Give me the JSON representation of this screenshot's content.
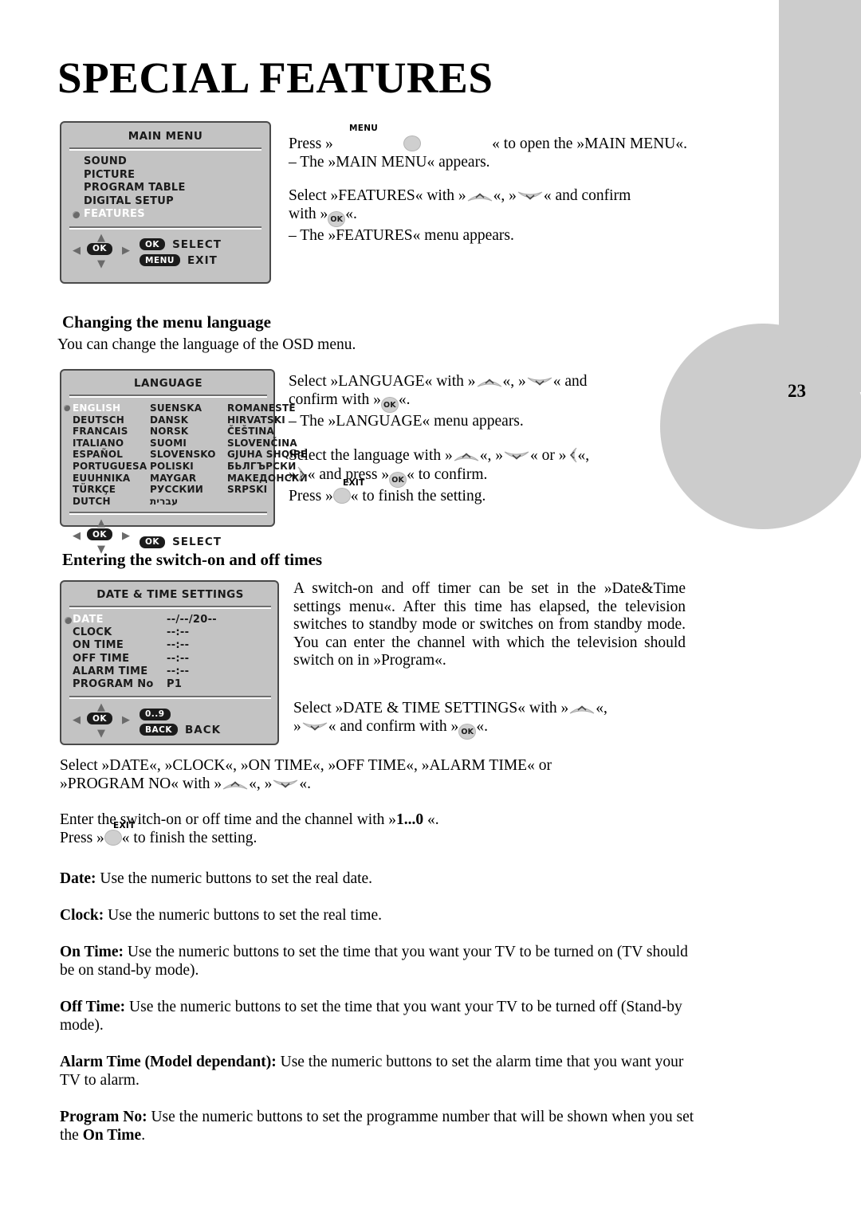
{
  "page": {
    "title": "SPECIAL FEATURES",
    "number": "23"
  },
  "main_menu_osd": {
    "title": "MAIN MENU",
    "items": [
      "SOUND",
      "PICTURE",
      "PROGRAM TABLE",
      "DIGITAL SETUP",
      "FEATURES"
    ],
    "selected": "FEATURES",
    "nav": {
      "ok_key": "OK",
      "ok_action": "SELECT",
      "menu_key": "MENU",
      "menu_action": "EXIT"
    }
  },
  "intro": {
    "line1_a": "Press »",
    "line1_b": "« to open the »MAIN MENU«.",
    "menu_key_label": "MENU",
    "line2": "– The »MAIN MENU« appears.",
    "line3_a": "Select »FEATURES« with »",
    "line3_b": "«, »",
    "line3_c": "« and confirm",
    "line4_a": "with »",
    "line4_b": "«.",
    "ok_key_label": "OK",
    "line5": "– The »FEATURES« menu appears."
  },
  "language_section": {
    "heading": "Changing the menu language",
    "intro": "You can change the language of the OSD menu.",
    "osd": {
      "title": "LANGUAGE",
      "columns": [
        [
          "ENGLISH",
          "DEUTSCH",
          "FRANCAIS",
          "ITALIANO",
          "ESPAÑOL",
          "PORTUGUESA",
          "EUUHNIKA",
          "TÜRKÇE",
          "DUTCH"
        ],
        [
          "SUENSKA",
          "DANSK",
          "NORSK",
          "SUOMI",
          "SLOVENSKO",
          "POLISKI",
          "MAYGAR",
          "РУССКИИ",
          "עברית"
        ],
        [
          "ROMANESTE",
          "HIRVATSKI",
          "ČEŠTINA",
          "SLOVENČINA",
          "GJUHA SHQIPE",
          "БЬЛГЪРСКИ",
          "МАКЕДОНСКИ",
          "SRPSKI",
          ""
        ]
      ],
      "selected": "ENGLISH",
      "nav": {
        "ok_key": "OK",
        "ok_action": "SELECT"
      }
    },
    "text": {
      "p1_a": "Select  »LANGUAGE«  with  »",
      "p1_b": "«, »",
      "p1_c": "« and",
      "p2_a": " confirm   with »",
      "p2_b": "«.",
      "p3": "– The »LANGUAGE« menu appears.",
      "p4_a": "Select  the  language  with  »",
      "p4_b": "«, »",
      "p4_c": "« or »",
      "p4_d": "«,",
      "p5_a": "»",
      "p5_b": "« and  press  »",
      "p5_c": "«  to  confirm.",
      "p6_a": "Press »",
      "p6_b": "« to finish the setting.",
      "exit_key_label": "EXIT",
      "ok_key_label": "OK"
    }
  },
  "timer_section": {
    "heading": "Entering the switch-on and off times",
    "osd": {
      "title": "DATE & TIME SETTINGS",
      "rows": [
        {
          "key": "DATE",
          "value": "--/--/20--"
        },
        {
          "key": "CLOCK",
          "value": "--:--"
        },
        {
          "key": "ON TIME",
          "value": "--:--"
        },
        {
          "key": "OFF TIME",
          "value": "--:--"
        },
        {
          "key": "ALARM TIME",
          "value": "--:--"
        },
        {
          "key": "PROGRAM No",
          "value": "P1"
        }
      ],
      "selected": "DATE",
      "nav": {
        "ok_key": "OK",
        "numeric_key": "0..9",
        "back_key": "BACK",
        "back_action": "BACK"
      }
    },
    "paragraph": "A switch-on and off timer can be set in the »Date&Time settings menu«. After this time has elapsed, the television switches to standby mode or switches on from standby mode. You can enter the channel  with  which the television should switch on in »Program«.",
    "select_line_a": "Select »DATE & TIME SETTINGS« with »",
    "select_line_b": "«,",
    "select_line_c": "»",
    "select_line_d": "« and confirm with »",
    "select_line_e": "«.",
    "ok_key_label": "OK",
    "select_items_a": "Select  »DATE«,  »CLOCK«,  »ON TIME«,  »OFF TIME«, »ALARM TIME« or",
    "select_items_b": "»PROGRAM NO« with »",
    "select_items_c": "«, »",
    "select_items_d": "«.",
    "enter_a": "Enter   the   switch-on   or   off   time   and   the   channel  with   »",
    "enter_bold": "1...0",
    "enter_b": " «.",
    "enter_c_a": "Press »",
    "enter_c_b": "« to finish the setting.",
    "exit_key_label": "EXIT"
  },
  "definitions": [
    {
      "term": "Date:",
      "body": " Use the numeric buttons to set the real date."
    },
    {
      "term": "Clock:",
      "body": " Use the numeric buttons to set the real time."
    },
    {
      "term": "On Time:",
      "body": " Use the numeric buttons to set the time that you want your TV to be turned on (TV should be on stand-by mode)."
    },
    {
      "term": "Off Time:",
      "body": " Use the numeric buttons to set the time that you want your TV to be turned off (Stand-by mode)."
    },
    {
      "term": "Alarm Time (Model dependant):",
      "body": " Use the numeric buttons to set the alarm time that you want your TV to alarm."
    },
    {
      "term": "Program No:",
      "body": " Use the numeric buttons to set the programme number that will be shown when you set the ",
      "bold_tail": "On Time",
      "tail": "."
    }
  ],
  "colors": {
    "deco_gray": "#cccccc",
    "osd_bg": "#c3c3c3",
    "osd_border": "#4a4a4a",
    "keycap_bg": "#1b1b1b"
  }
}
